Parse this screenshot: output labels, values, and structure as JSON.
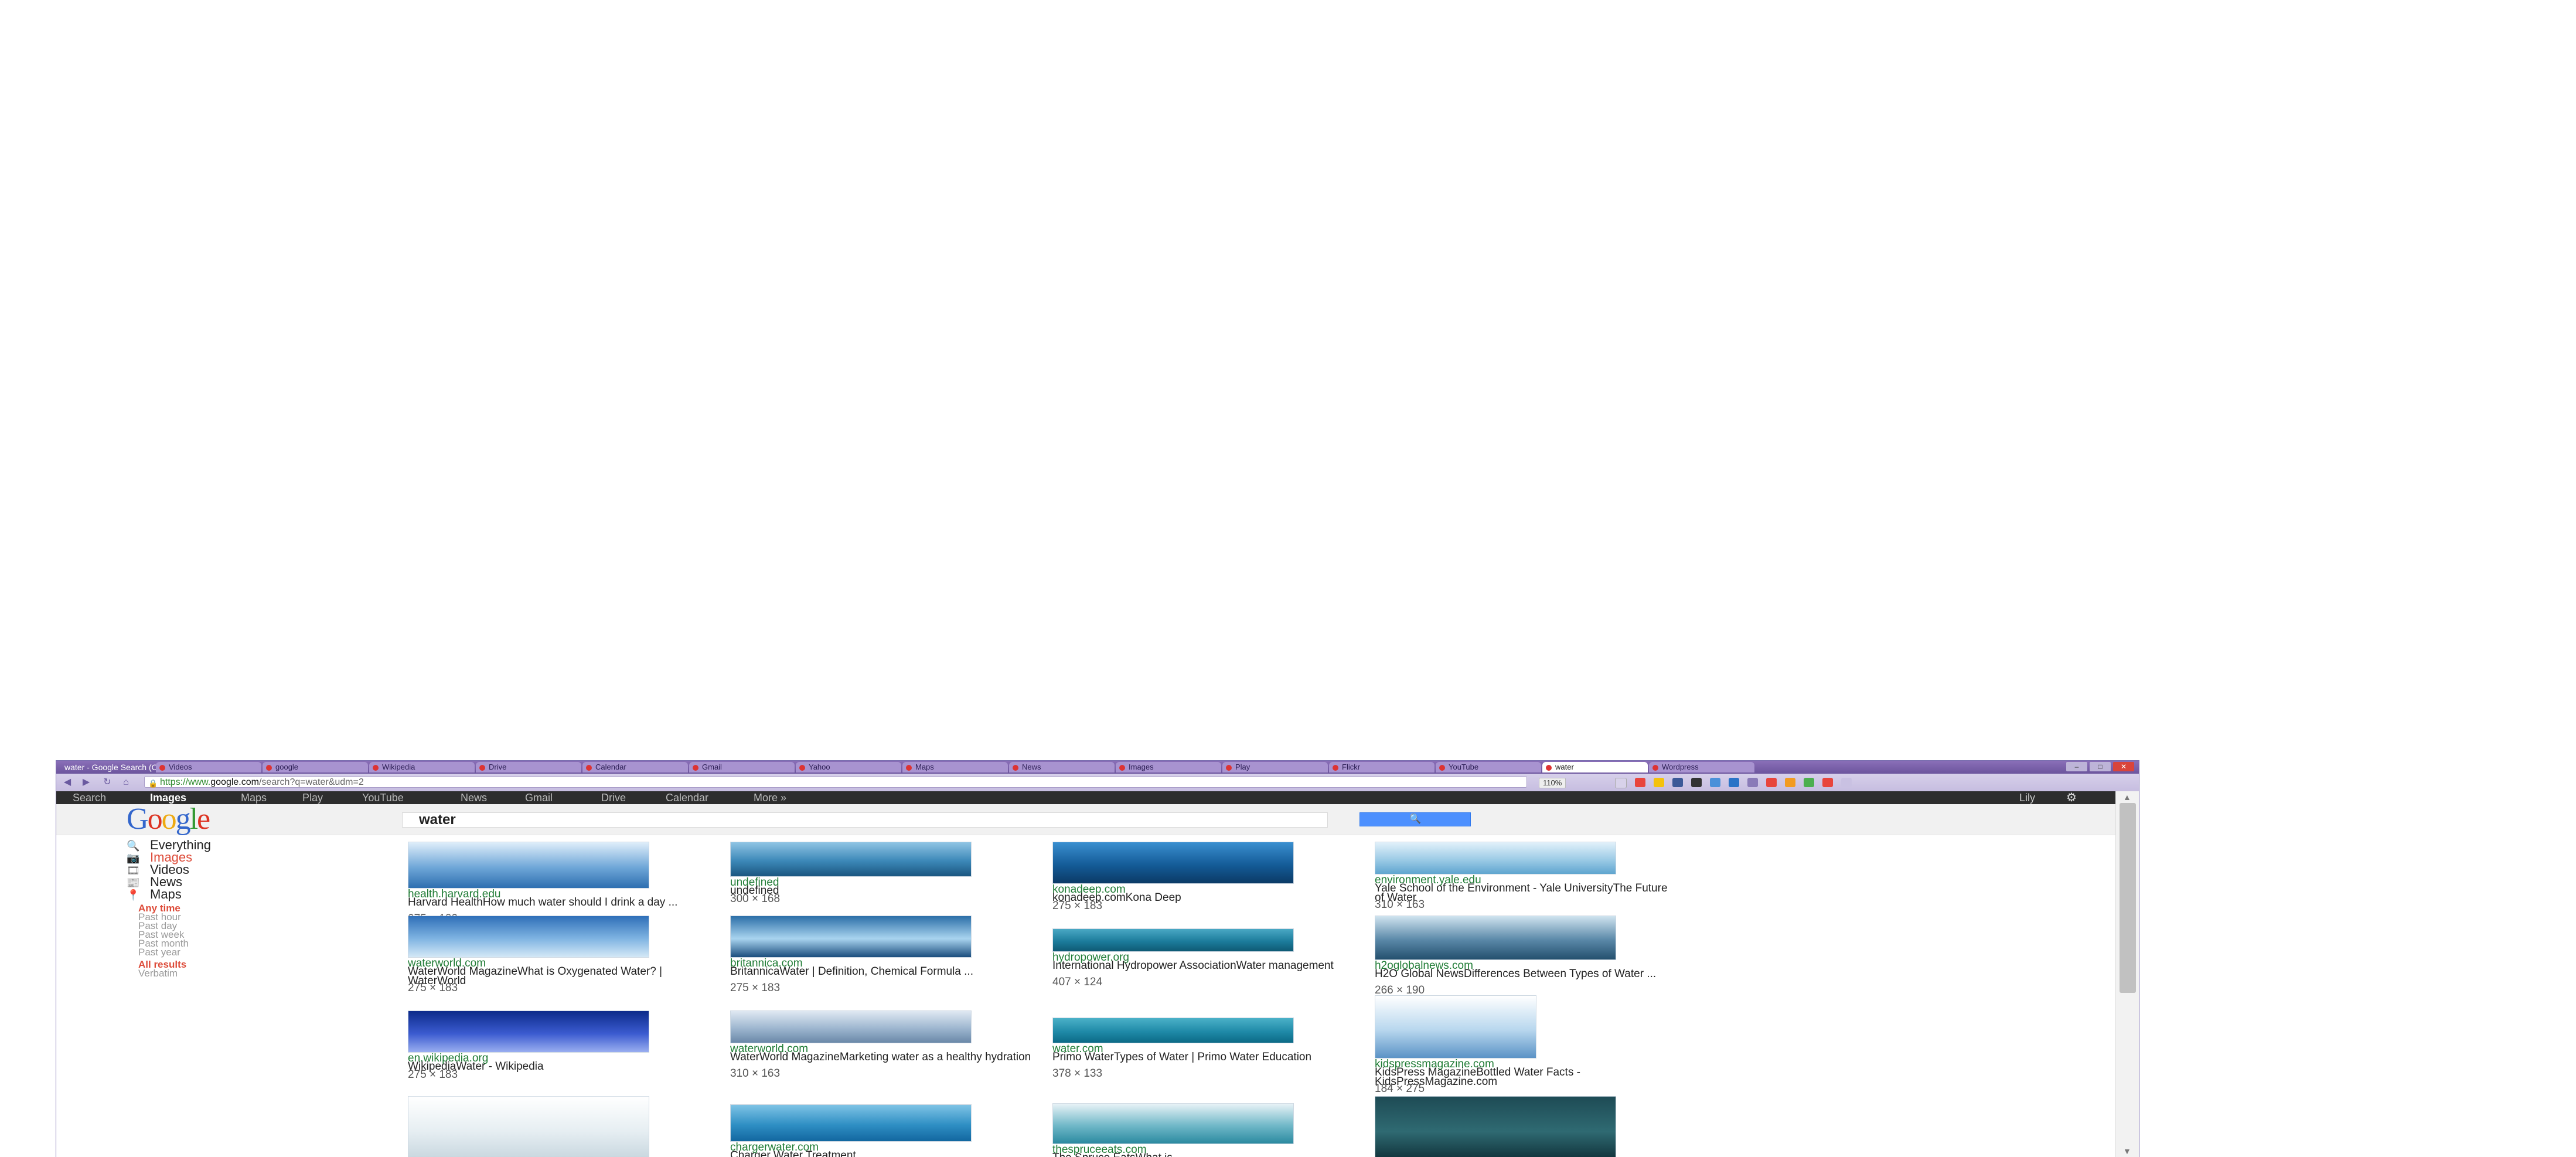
{
  "window": {
    "title": "water - Google Search (Chromium)",
    "tabs": [
      {
        "label": "Videos",
        "active": false
      },
      {
        "label": "google",
        "active": false
      },
      {
        "label": "Wikipedia",
        "active": false
      },
      {
        "label": "Drive",
        "active": false
      },
      {
        "label": "Calendar",
        "active": false
      },
      {
        "label": "Gmail",
        "active": false
      },
      {
        "label": "Yahoo",
        "active": false
      },
      {
        "label": "Maps",
        "active": false
      },
      {
        "label": "News",
        "active": false
      },
      {
        "label": "Images",
        "active": false
      },
      {
        "label": "Play",
        "active": false
      },
      {
        "label": "Flickr",
        "active": false
      },
      {
        "label": "YouTube",
        "active": false
      },
      {
        "label": "water",
        "active": true
      },
      {
        "label": "Wordpress",
        "active": false
      }
    ]
  },
  "address_bar": {
    "scheme": "https://www.",
    "host": "google.com",
    "path": "/search?q=water&udm=2",
    "zoom": "110%"
  },
  "gbar": {
    "links": [
      "Search",
      "Images",
      "Maps",
      "Play",
      "YouTube",
      "News",
      "Gmail",
      "Drive",
      "Calendar",
      "More »"
    ],
    "current": "Images",
    "user": "Lily"
  },
  "logo": {
    "letters": [
      "G",
      "o",
      "o",
      "g",
      "l",
      "e"
    ]
  },
  "search": {
    "query": "water",
    "button_icon": "search-icon"
  },
  "sidebar": {
    "items": [
      {
        "label": "Everything",
        "icon": "search-icon",
        "active": false
      },
      {
        "label": "Images",
        "icon": "camera-icon",
        "active": true
      },
      {
        "label": "Videos",
        "icon": "film-icon",
        "active": false
      },
      {
        "label": "News",
        "icon": "newspaper-icon",
        "active": false
      },
      {
        "label": "Maps",
        "icon": "map-pin-icon",
        "active": false
      }
    ],
    "time_filters": [
      "Any time",
      "Past hour",
      "Past day",
      "Past week",
      "Past month",
      "Past year"
    ],
    "result_filters": [
      "All results",
      "Verbatim"
    ]
  },
  "results": [
    {
      "source": "health.harvard.edu",
      "caption": "Harvard HealthHow much water should I drink a day ...",
      "dims": "275 × 183"
    },
    {
      "source": "undefined",
      "caption": "undefined",
      "dims": "300 × 168"
    },
    {
      "source": "konadeep.com",
      "caption": "konadeep.comKona Deep",
      "dims": "275 × 183"
    },
    {
      "source": "environment.yale.edu",
      "caption": "Yale School of the Environment - Yale UniversityThe Future of Water",
      "dims": "310 × 163"
    },
    {
      "source": "waterworld.com",
      "caption": "WaterWorld MagazineWhat is Oxygenated Water? | WaterWorld",
      "dims": "275 × 183"
    },
    {
      "source": "britannica.com",
      "caption": "BritannicaWater | Definition, Chemical Formula ...",
      "dims": "275 × 183"
    },
    {
      "source": "hydropower.org",
      "caption": "International Hydropower AssociationWater management",
      "dims": "407 × 124"
    },
    {
      "source": "h2oglobalnews.com",
      "caption": "H2O Global NewsDifferences Between Types of Water ...",
      "dims": "266 × 190"
    },
    {
      "source": "en.wikipedia.org",
      "caption": "WikipediaWater - Wikipedia",
      "dims": "275 × 183"
    },
    {
      "source": "waterworld.com",
      "caption": "WaterWorld MagazineMarketing water as a healthy hydration",
      "dims": "310 × 163"
    },
    {
      "source": "water.com",
      "caption": "Primo WaterTypes of Water | Primo Water Education",
      "dims": "378 × 133"
    },
    {
      "source": "kidspressmagazine.com",
      "caption": "KidsPress MagazineBottled Water Facts - KidsPressMagazine.com",
      "dims": "184 × 275"
    },
    {
      "source": "",
      "caption": "",
      "dims": ""
    },
    {
      "source": "chargerwater.com",
      "caption": "Charger Water Treatment",
      "dims": ""
    },
    {
      "source": "thespruceeats.com",
      "caption": "The Spruce EatsWhat is",
      "dims": ""
    },
    {
      "source": "",
      "caption": "",
      "dims": ""
    }
  ],
  "colors": {
    "google_blue": "#3366cc",
    "google_red": "#dd3322",
    "google_yellow": "#eeaa11",
    "google_green": "#339933",
    "source_green": "#1e7b34",
    "active_red": "#dd4b39",
    "titlebar_purple": "#7b62aa"
  }
}
